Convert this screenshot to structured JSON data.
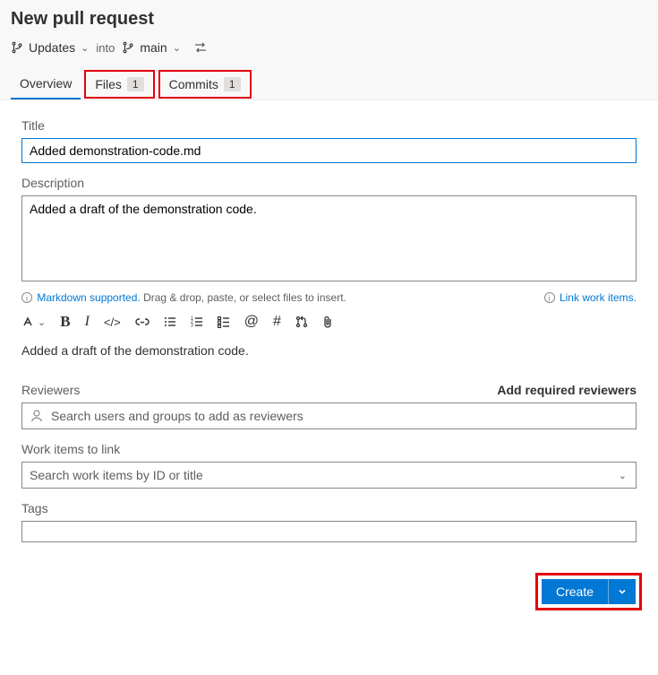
{
  "header": {
    "title": "New pull request",
    "source_branch": "Updates",
    "into_label": "into",
    "target_branch": "main"
  },
  "tabs": {
    "overview": "Overview",
    "files_label": "Files",
    "files_count": "1",
    "commits_label": "Commits",
    "commits_count": "1"
  },
  "form": {
    "title_label": "Title",
    "title_value": "Added demonstration-code.md",
    "desc_label": "Description",
    "desc_value": "Added a draft of the demonstration code.",
    "md_supported": "Markdown supported.",
    "md_hint": " Drag & drop, paste, or select files to insert.",
    "link_work_items": "Link work items.",
    "preview": "Added a draft of the demonstration code."
  },
  "reviewers": {
    "label": "Reviewers",
    "add_required": "Add required reviewers",
    "placeholder": "Search users and groups to add as reviewers"
  },
  "workitems": {
    "label": "Work items to link",
    "placeholder": "Search work items by ID or title"
  },
  "tags": {
    "label": "Tags"
  },
  "actions": {
    "create": "Create"
  }
}
